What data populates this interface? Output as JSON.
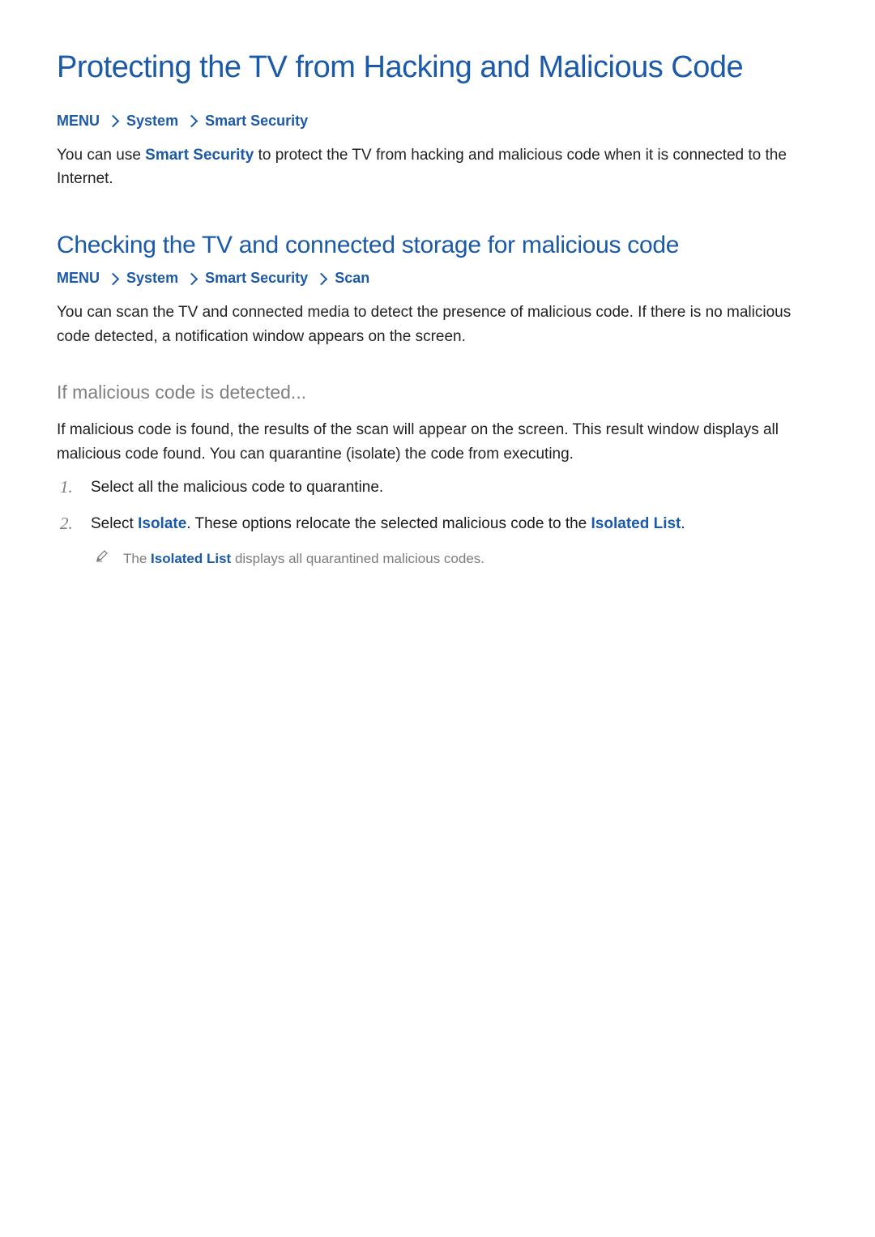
{
  "title": "Protecting the TV from Hacking and Malicious Code",
  "bc1": {
    "p0": "MENU",
    "p1": "System",
    "p2": "Smart Security"
  },
  "intro": {
    "t0": "You can use ",
    "k0": "Smart Security",
    "t1": " to protect the TV from hacking and malicious code when it is connected to the Internet."
  },
  "h2": "Checking the TV and connected storage for malicious code",
  "bc2": {
    "p0": "MENU",
    "p1": "System",
    "p2": "Smart Security",
    "p3": "Scan"
  },
  "p2": "You can scan the TV and connected media to detect the presence of malicious code. If there is no malicious code detected, a notification window appears on the screen.",
  "h3": "If malicious code is detected...",
  "p3": "If malicious code is found, the results of the scan will appear on the screen. This result window displays all malicious code found. You can quarantine (isolate) the code from executing.",
  "step1": "Select all the malicious code to quarantine.",
  "step2": {
    "t0": "Select ",
    "k0": "Isolate",
    "t1": ". These options relocate the selected malicious code to the ",
    "k1": "Isolated List",
    "t2": "."
  },
  "note": {
    "t0": "The ",
    "k0": "Isolated List",
    "t1": " displays all quarantined malicious codes."
  }
}
